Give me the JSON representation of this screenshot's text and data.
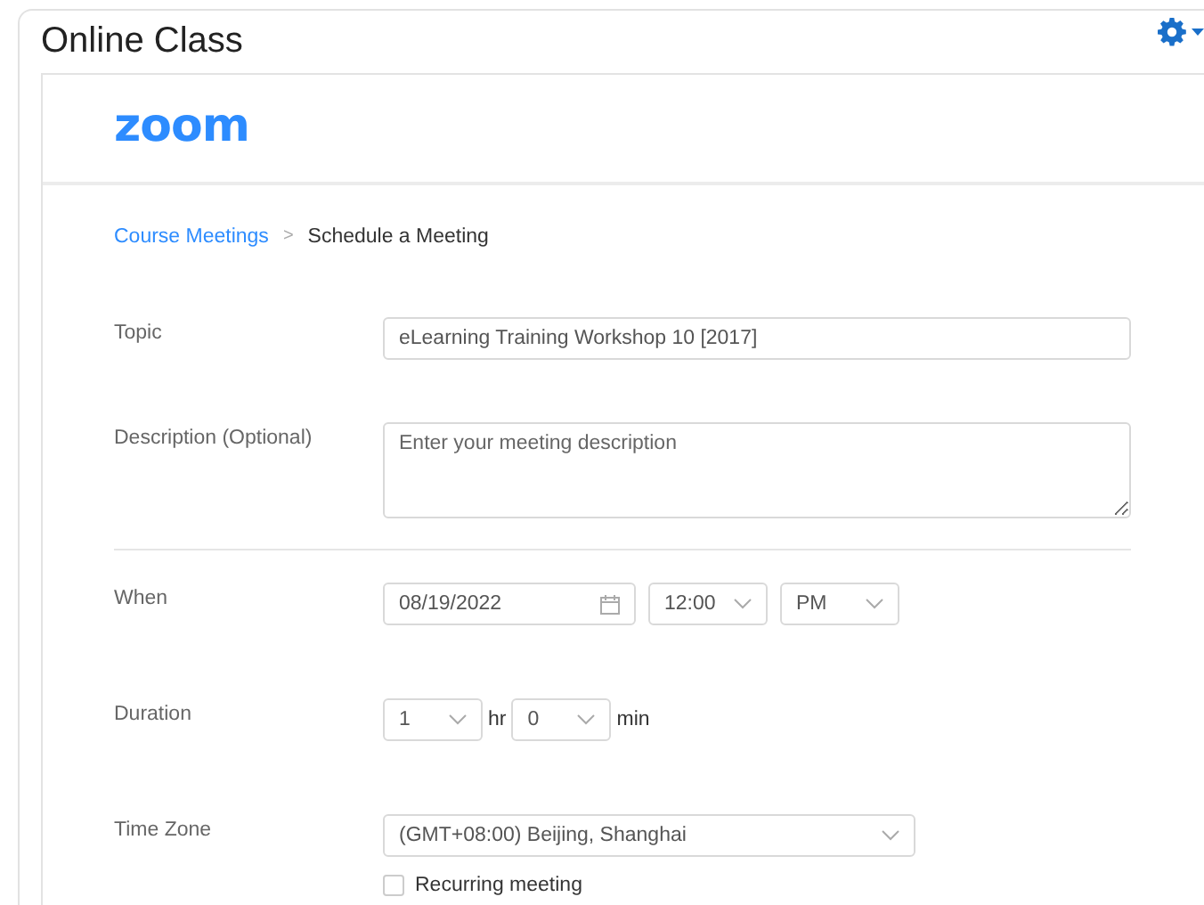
{
  "page": {
    "title": "Online Class"
  },
  "logo": "zoom",
  "breadcrumb": {
    "link": "Course Meetings",
    "separator": ">",
    "current": "Schedule a Meeting"
  },
  "form": {
    "topic": {
      "label": "Topic",
      "value": "eLearning Training Workshop 10 [2017]"
    },
    "description": {
      "label": "Description (Optional)",
      "placeholder": "Enter your meeting description"
    },
    "when": {
      "label": "When",
      "date": "08/19/2022",
      "time": "12:00",
      "meridiem": "PM"
    },
    "duration": {
      "label": "Duration",
      "hours": "1",
      "hours_unit": "hr",
      "minutes": "0",
      "minutes_unit": "min"
    },
    "time_zone": {
      "label": "Time Zone",
      "value": "(GMT+08:00) Beijing, Shanghai"
    },
    "recurring": {
      "label": "Recurring meeting",
      "checked": false
    }
  }
}
